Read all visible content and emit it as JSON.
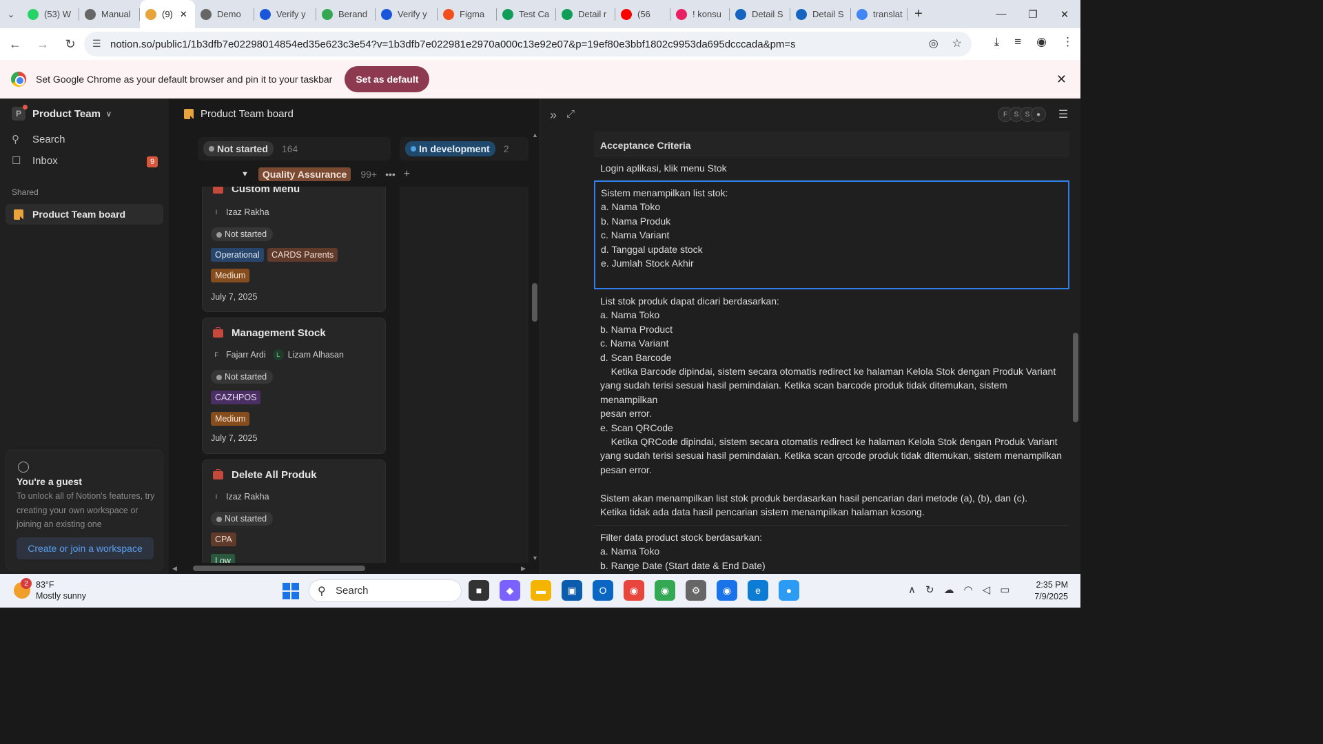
{
  "browser": {
    "tabs": [
      {
        "label": "(53) W",
        "color": "#25d366"
      },
      {
        "label": "Manual",
        "color": "#666"
      },
      {
        "label": "(9)",
        "color": "#e8a33a"
      },
      {
        "label": "Demo",
        "color": "#666"
      },
      {
        "label": "Verify y",
        "color": "#1a56db"
      },
      {
        "label": "Berand",
        "color": "#34a853"
      },
      {
        "label": "Verify y",
        "color": "#1a56db"
      },
      {
        "label": "Figma",
        "color": "#f24e1e"
      },
      {
        "label": "Test Ca",
        "color": "#0f9d58"
      },
      {
        "label": "Detail r",
        "color": "#0f9d58"
      },
      {
        "label": "(56",
        "color": "#ff0000"
      },
      {
        "label": "! konsu",
        "color": "#e91e63"
      },
      {
        "label": "Detail S",
        "color": "#1565c0"
      },
      {
        "label": "Detail S",
        "color": "#1565c0"
      },
      {
        "label": "translat",
        "color": "#4285f4"
      }
    ],
    "url": "notion.so/public1/1b3dfb7e02298014854ed35e623c3e54?v=1b3dfb7e022981e2970a000c13e92e07&p=19ef80e3bbf1802c9953da695dcccada&pm=s"
  },
  "banner": {
    "text": "Set Google Chrome as your default browser and pin it to your taskbar",
    "button": "Set as default"
  },
  "sidebar": {
    "workspace": "Product Team",
    "workspace_initial": "P",
    "search": "Search",
    "inbox": "Inbox",
    "inbox_count": "9",
    "shared_label": "Shared",
    "shared_page": "Product Team board",
    "guest": {
      "title": "You're a guest",
      "desc": "To unlock all of Notion's features, try creating your own workspace or joining an existing one",
      "button": "Create or join a workspace"
    }
  },
  "board": {
    "title": "Product Team board",
    "columns": [
      {
        "status": "Not started",
        "count": "164"
      },
      {
        "status": "In development",
        "count": "2"
      }
    ],
    "group": {
      "label": "Quality Assurance",
      "count": "99+"
    },
    "cards": [
      {
        "title": "Custom Menu",
        "people": [
          {
            "initial": "I",
            "name": "Izaz Rakha"
          }
        ],
        "status": "Not started",
        "tags": [
          "Operational",
          "CARDS Parents"
        ],
        "priority": "Medium",
        "date": "July 7, 2025"
      },
      {
        "title": "Management Stock",
        "people": [
          {
            "initial": "F",
            "name": "Fajarr Ardi"
          },
          {
            "initial": "L",
            "name": "Lizam Alhasan"
          }
        ],
        "status": "Not started",
        "tags": [
          "CAZHPOS"
        ],
        "priority": "Medium",
        "date": "July 7, 2025"
      },
      {
        "title": "Delete All Produk",
        "people": [
          {
            "initial": "I",
            "name": "Izaz Rakha"
          }
        ],
        "status": "Not started",
        "tags": [
          "CPA"
        ],
        "priority": "Low",
        "date": ""
      }
    ]
  },
  "peek": {
    "avatars": [
      "F",
      "S",
      "S"
    ],
    "rows": [
      {
        "type": "head",
        "lines": [
          "Acceptance Criteria"
        ]
      },
      {
        "type": "normal",
        "lines": [
          "Login aplikasi, klik menu Stok"
        ]
      },
      {
        "type": "selected",
        "lines": [
          "Sistem menampilkan list stok:",
          "a. Nama Toko",
          "b. Nama Produk",
          "c. Nama Variant",
          "d. Tanggal update stock",
          "e. Jumlah Stock Akhir",
          ""
        ]
      },
      {
        "type": "normal",
        "lines": [
          "List stok produk dapat dicari berdasarkan:",
          "a. Nama Toko",
          "b. Nama Product",
          "c. Nama Variant",
          "d. Scan Barcode",
          "    Ketika Barcode dipindai, sistem secara otomatis redirect ke halaman Kelola Stok dengan Produk Variant",
          "yang sudah terisi sesuai hasil pemindaian. Ketika scan barcode produk tidak ditemukan, sistem menampilkan",
          "pesan error.",
          "e. Scan QRCode",
          "    Ketika QRCode dipindai, sistem secara otomatis redirect ke halaman Kelola Stok dengan Produk Variant",
          "yang sudah terisi sesuai hasil pemindaian. Ketika scan qrcode produk tidak ditemukan, sistem menampilkan",
          "pesan error.",
          "",
          "Sistem akan menampilkan list stok produk berdasarkan hasil pencarian dari metode (a), (b), dan (c).",
          "Ketika tidak ada data hasil pencarian sistem menampilkan halaman kosong.",
          ""
        ]
      },
      {
        "type": "normal",
        "lines": [
          "Filter data product stock berdasarkan:",
          "a. Nama Toko",
          "b. Range Date (Start date & End Date)"
        ]
      }
    ]
  },
  "taskbar": {
    "temp": "83°F",
    "weather": "Mostly sunny",
    "weather_badge": "2",
    "search": "Search",
    "time": "2:35 PM",
    "date": "7/9/2025"
  }
}
